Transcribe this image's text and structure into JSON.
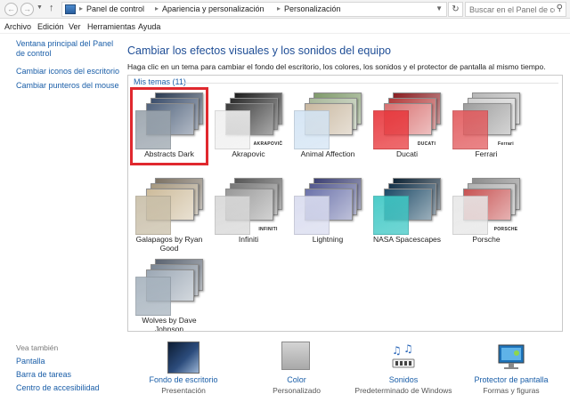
{
  "address_bar": {
    "crumbs": [
      "Panel de control",
      "Apariencia y personalización",
      "Personalización"
    ],
    "search_placeholder": "Buscar en el Panel de control"
  },
  "menu": [
    "Archivo",
    "Edición",
    "Ver",
    "Herramientas",
    "Ayuda"
  ],
  "sidebar": {
    "links": [
      "Ventana principal del Panel de control",
      "Cambiar iconos del escritorio",
      "Cambiar punteros del mouse"
    ],
    "see_also_title": "Vea también",
    "see_also": [
      "Pantalla",
      "Barra de tareas",
      "Centro de accesibilidad"
    ]
  },
  "main": {
    "title": "Cambiar los efectos visuales y los sonidos del equipo",
    "description": "Haga clic en un tema para cambiar el fondo del escritorio, los colores, los sonidos y el protector de pantalla al mismo tiempo.",
    "group_label": "Mis temas (11)",
    "selected_theme": "Abstracts Dark",
    "themes": [
      {
        "name": "Abstracts Dark",
        "color": "#9aa4ad",
        "imgs": [
          "#2b3b52",
          "#3a4d6b",
          "#50627c"
        ],
        "badge": ""
      },
      {
        "name": "Akrapovic",
        "color": "#f0f0f0",
        "imgs": [
          "#1c1c1c",
          "#2a2a2a",
          "#3b3b3b"
        ],
        "badge": "AKRAPOVIČ"
      },
      {
        "name": "Animal Affection",
        "color": "#d3e4f4",
        "imgs": [
          "#7f9a6a",
          "#a8b89a",
          "#c9b8a0"
        ],
        "badge": ""
      },
      {
        "name": "Ducati",
        "color": "#e8383d",
        "imgs": [
          "#8a1d20",
          "#b23a3a",
          "#d86f6f"
        ],
        "badge": "DUCATI"
      },
      {
        "name": "Ferrari",
        "color": "#e25b5e",
        "imgs": [
          "#b7b7b7",
          "#cfcfcf",
          "#9e9e9e"
        ],
        "badge": "Ferrari"
      },
      {
        "name": "Galapagos by Ryan Good",
        "color": "#c9bfa9",
        "imgs": [
          "#7b7163",
          "#a6987f",
          "#cdbb9a"
        ],
        "badge": ""
      },
      {
        "name": "Infiniti",
        "color": "#d8d8d8",
        "imgs": [
          "#555555",
          "#777777",
          "#999999"
        ],
        "badge": "INFINITI"
      },
      {
        "name": "Lightning",
        "color": "#d9dcef",
        "imgs": [
          "#3b3f73",
          "#52588f",
          "#6b72aa"
        ],
        "badge": ""
      },
      {
        "name": "NASA Spacescapes",
        "color": "#3fc8c5",
        "imgs": [
          "#0c2234",
          "#13324a",
          "#1d4a66"
        ],
        "badge": ""
      },
      {
        "name": "Porsche",
        "color": "#e7e7e7",
        "imgs": [
          "#8c8c8c",
          "#b0b0b0",
          "#c75252"
        ],
        "badge": "PORSCHE"
      },
      {
        "name": "Wolves by Dave Johnson",
        "color": "#a7b3be",
        "imgs": [
          "#5a6370",
          "#7a8694",
          "#9ba7b4"
        ],
        "badge": ""
      }
    ]
  },
  "bottom": [
    {
      "label": "Fondo de escritorio",
      "sub": "Presentación",
      "icon": "desktop-background-icon"
    },
    {
      "label": "Color",
      "sub": "Personalizado",
      "icon": "color-swatch-icon"
    },
    {
      "label": "Sonidos",
      "sub": "Predeterminado de Windows",
      "icon": "sounds-icon"
    },
    {
      "label": "Protector de pantalla",
      "sub": "Formas y figuras",
      "icon": "screensaver-icon"
    }
  ]
}
